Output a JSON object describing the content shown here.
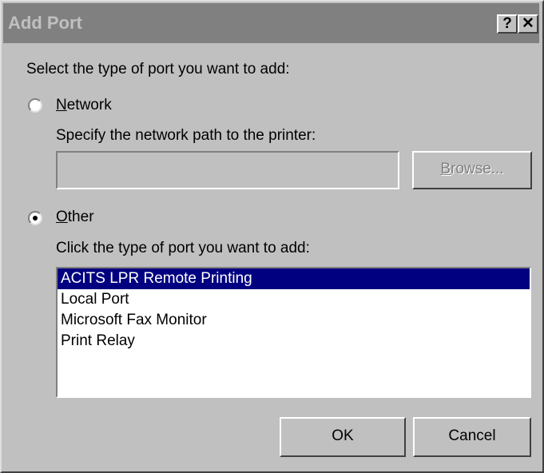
{
  "dialog": {
    "title": "Add Port",
    "help_button": "?",
    "close_button": "✕",
    "prompt": "Select the type of port you want to add:"
  },
  "network": {
    "label_accel": "N",
    "label_rest": "etwork",
    "selected": false,
    "path_label": "Specify the network path to the printer:",
    "path_value": "",
    "browse_accel": "B",
    "browse_rest": "rowse..."
  },
  "other": {
    "label_accel": "O",
    "label_rest": "ther",
    "selected": true,
    "list_label": "Click the type of port you want to add:",
    "ports": [
      "ACITS LPR Remote Printing",
      "Local Port",
      "Microsoft Fax Monitor",
      "Print Relay"
    ],
    "selected_port": "ACITS LPR Remote Printing"
  },
  "buttons": {
    "ok": "OK",
    "cancel": "Cancel"
  }
}
